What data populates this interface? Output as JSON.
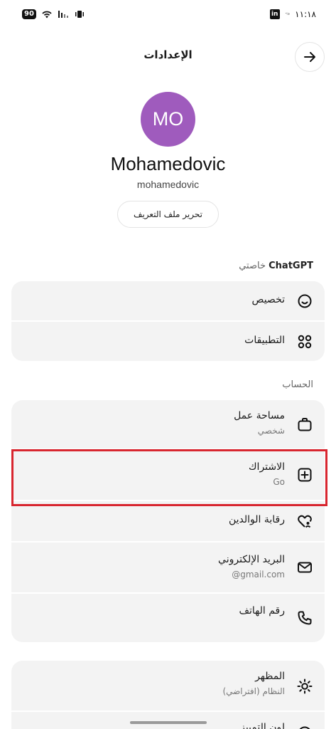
{
  "status_bar": {
    "battery": "90",
    "linkedin": "in",
    "speed": "ৼ৹৹",
    "time": "١١:١٨"
  },
  "header": {
    "title": "الإعدادات",
    "back_icon": "arrow-right-icon"
  },
  "profile": {
    "initials": "MO",
    "avatar_color": "#9f5bbd",
    "display_name": "Mohamedovic",
    "username": "mohamedovic",
    "edit_button": "تحرير ملف التعريف"
  },
  "sections": {
    "chatgpt": {
      "brand": "ChatGPT",
      "suffix": "خاصتي"
    },
    "account": {
      "label": "الحساب"
    }
  },
  "chatgpt_items": [
    {
      "label": "تخصيص",
      "icon": "smiley-icon"
    },
    {
      "label": "التطبيقات",
      "icon": "apps-grid-icon"
    }
  ],
  "account_items": [
    {
      "label": "مساحة عمل",
      "sub": "شخصي",
      "icon": "briefcase-icon"
    },
    {
      "label": "الاشتراك",
      "sub": "Go",
      "icon": "plus-square-icon"
    },
    {
      "label": "رقابة الوالدين",
      "icon": "parental-heart-icon"
    },
    {
      "label": "البريد الإلكتروني",
      "sub": "@gmail.com",
      "icon": "mail-icon"
    },
    {
      "label": "رقم الهاتف",
      "icon": "phone-icon"
    }
  ],
  "app_items": [
    {
      "label": "المظهر",
      "sub": "النظام (افتراضي)",
      "icon": "sun-icon"
    },
    {
      "label": "لون التمييز",
      "icon": "palette-icon"
    }
  ],
  "colors": {
    "highlight": "#d8262f",
    "row_background": "#f3f3f3"
  }
}
